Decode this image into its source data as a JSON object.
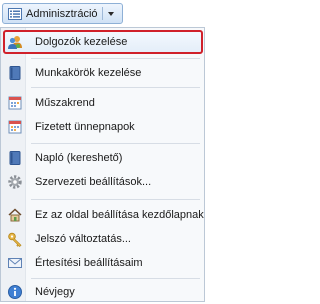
{
  "menu_button": {
    "label": "Adminisztráció",
    "icon": "list-icon"
  },
  "items": [
    {
      "label": "Dolgozók kezelése",
      "icon": "users-icon"
    },
    {
      "label": "Munkakörök kezelése",
      "icon": "book-icon"
    },
    {
      "label": "Műszakrend",
      "icon": "calendar-icon"
    },
    {
      "label": "Fizetett ünnepnapok",
      "icon": "calendar-holiday-icon"
    },
    {
      "label": "Napló (kereshető)",
      "icon": "log-book-icon"
    },
    {
      "label": "Szervezeti beállítások...",
      "icon": "gear-icon"
    },
    {
      "label": "Ez az oldal beállítása kezdőlapnak",
      "icon": "home-icon"
    },
    {
      "label": "Jelszó változtatás...",
      "icon": "key-icon"
    },
    {
      "label": "Értesítési beállításaim",
      "icon": "mail-icon"
    },
    {
      "label": "Névjegy",
      "icon": "info-icon"
    }
  ],
  "colors": {
    "selected_outline": "#d0202a",
    "menu_button_border": "#8eb0d6"
  }
}
